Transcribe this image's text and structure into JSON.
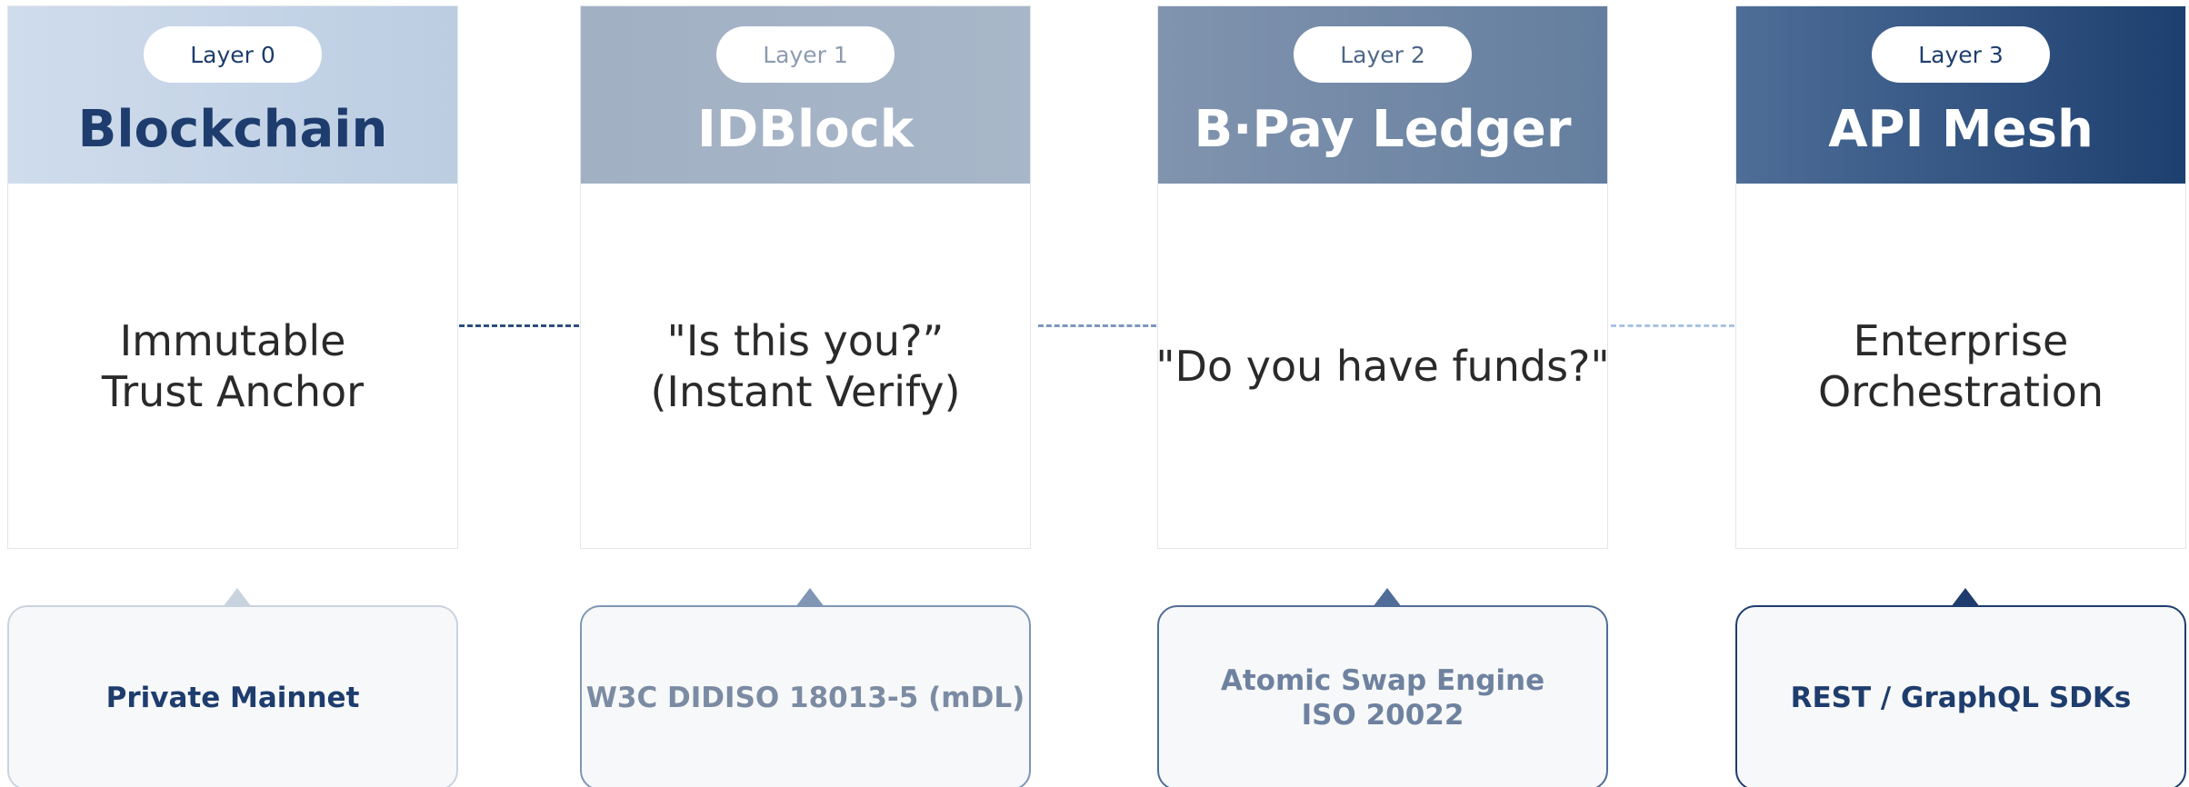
{
  "layers": [
    {
      "badge": "Layer 0",
      "title": "Blockchain",
      "body_lines": [
        "Immutable",
        "Trust Anchor"
      ],
      "tag_lines": [
        "Private Mainnet"
      ],
      "colors": {
        "header_from": "#cfdcec",
        "header_to": "#bccde2",
        "title": "#1e3d6e",
        "badge_text": "#1e3d6e",
        "tag_text": "#1e3d6e",
        "tag_border": "#c9d3df"
      }
    },
    {
      "badge": "Layer 1",
      "title": "IDBlock",
      "body_lines": [
        "\"Is this you?”",
        "(Instant Verify)"
      ],
      "tag_lines": [
        "W3C DIDISO 18013-5 (mDL)"
      ],
      "colors": {
        "header_from": "#a2b0c4",
        "header_to": "#a8b6c9",
        "title": "#ffffff",
        "badge_text": "#8c9bb0",
        "tag_text": "#7b8ba3",
        "tag_border": "#7f96b5"
      }
    },
    {
      "badge": "Layer 2",
      "title": "B·Pay Ledger",
      "body_lines": [
        "\"Do you have funds?\""
      ],
      "tag_lines": [
        "Atomic Swap Engine",
        "ISO 20022"
      ],
      "colors": {
        "header_from": "#8194ae",
        "header_to": "#647e9f",
        "title": "#ffffff",
        "badge_text": "#4d6788",
        "tag_text": "#6e82a0",
        "tag_border": "#4f6d97"
      }
    },
    {
      "badge": "Layer 3",
      "title": "API Mesh",
      "body_lines": [
        "Enterprise",
        "Orchestration"
      ],
      "tag_lines": [
        "REST / GraphQL SDKs"
      ],
      "colors": {
        "header_from": "#4e6e98",
        "header_to": "#1d3f6f",
        "title": "#ffffff",
        "badge_text": "#1e3d6e",
        "tag_text": "#1e3d6e",
        "tag_border": "#1e3d6e"
      }
    }
  ],
  "connector_colors": [
    "#2c4f7c",
    "#7b97c1",
    "#a9c2df"
  ]
}
